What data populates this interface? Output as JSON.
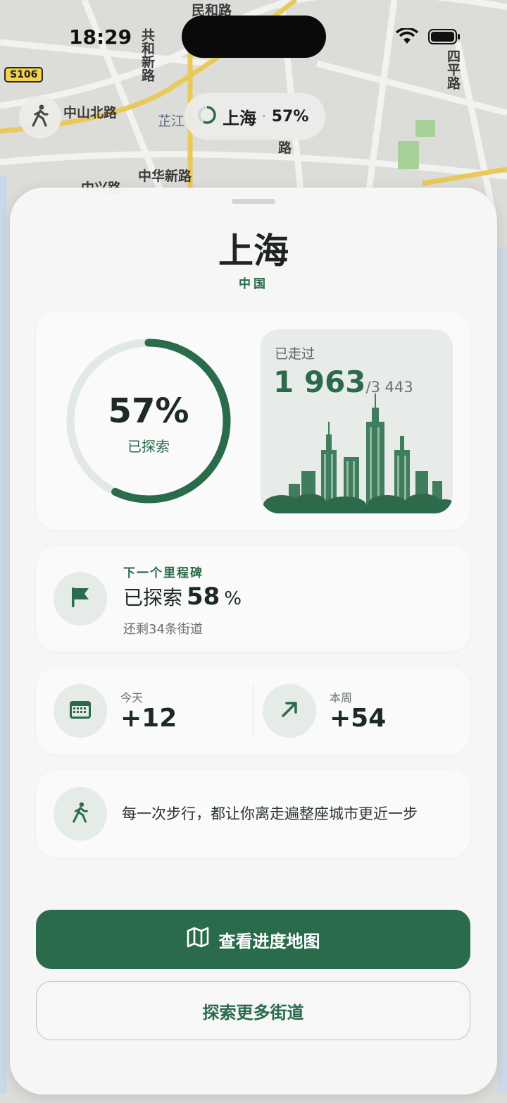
{
  "status_bar": {
    "time": "18:29"
  },
  "map": {
    "route_shield": "S106",
    "labels": [
      "民和路",
      "共和新路",
      "中山北路",
      "芷江",
      "中华新路",
      "中兴路",
      "四平路",
      "路"
    ]
  },
  "top_pill": {
    "city": "上海",
    "separator": "·",
    "percent": "57%"
  },
  "sheet": {
    "city": "上海",
    "country": "中国",
    "progress": {
      "percent_text": "57%",
      "percent_value": 57,
      "label": "已探索",
      "walked_label": "已走过",
      "walked_count": "1 963",
      "walked_total": "/3 443"
    },
    "milestone": {
      "kicker": "下一个里程碑",
      "text": "已探索",
      "target": "58",
      "unit": "%",
      "remaining": "还剩34条街道"
    },
    "stats": {
      "today_label": "今天",
      "today_value": "+12",
      "week_label": "本周",
      "week_value": "+54"
    },
    "quote": "每一次步行，都让你离走遍整座城市更近一步",
    "primary_button": "查看进度地图",
    "secondary_button": "探索更多街道"
  },
  "colors": {
    "accent": "#2a6b4c",
    "ring_track": "#e2e8e4"
  },
  "icons": [
    "walk-icon",
    "wifi-icon",
    "battery-icon",
    "progress-ring-icon",
    "flag-icon",
    "calendar-icon",
    "arrow-up-right-icon",
    "map-icon",
    "skyline-illustration"
  ]
}
